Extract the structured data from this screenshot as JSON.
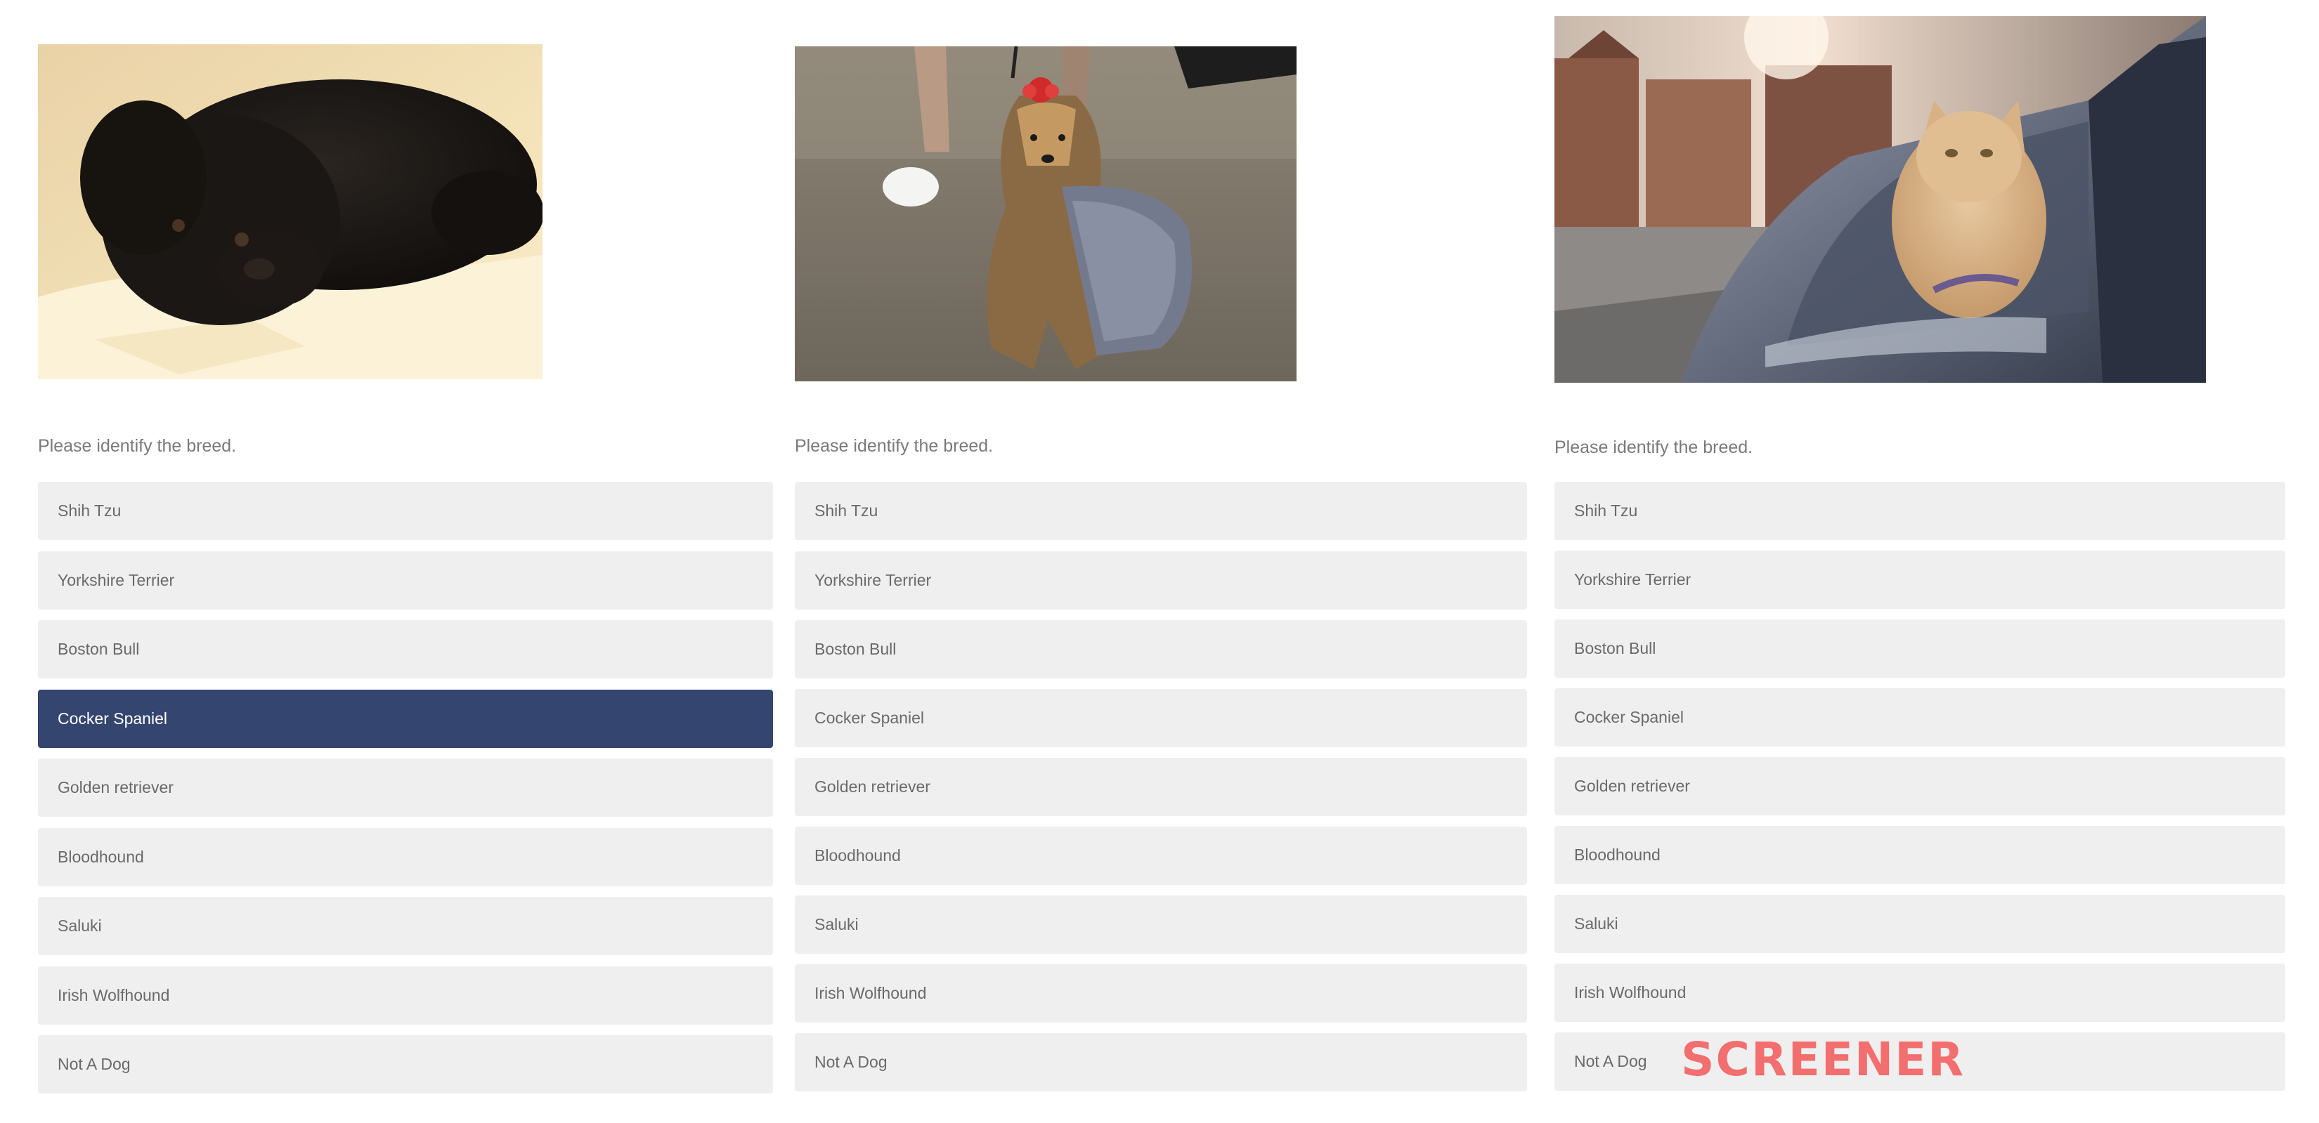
{
  "questions": [
    {
      "prompt": "Please identify the breed.",
      "image_subject": "black curly puppy lying down",
      "selected_index": 3,
      "options": [
        "Shih Tzu",
        "Yorkshire Terrier",
        "Boston Bull",
        "Cocker Spaniel",
        "Golden retriever",
        "Bloodhound",
        "Saluki",
        "Irish Wolfhound",
        "Not A Dog"
      ]
    },
    {
      "prompt": "Please identify the breed.",
      "image_subject": "yorkshire terrier with red bow on leash",
      "selected_index": -1,
      "options": [
        "Shih Tzu",
        "Yorkshire Terrier",
        "Boston Bull",
        "Cocker Spaniel",
        "Golden retriever",
        "Bloodhound",
        "Saluki",
        "Irish Wolfhound",
        "Not A Dog"
      ]
    },
    {
      "prompt": "Please identify the breed.",
      "image_subject": "ginger cat in car window",
      "selected_index": -1,
      "options": [
        "Shih Tzu",
        "Yorkshire Terrier",
        "Boston Bull",
        "Cocker Spaniel",
        "Golden retriever",
        "Bloodhound",
        "Saluki",
        "Irish Wolfhound",
        "Not A Dog"
      ]
    }
  ],
  "watermark": "SCREENER",
  "colors": {
    "selected_bg": "#34466f",
    "option_bg": "#efefef",
    "watermark": "#f36e6e"
  }
}
